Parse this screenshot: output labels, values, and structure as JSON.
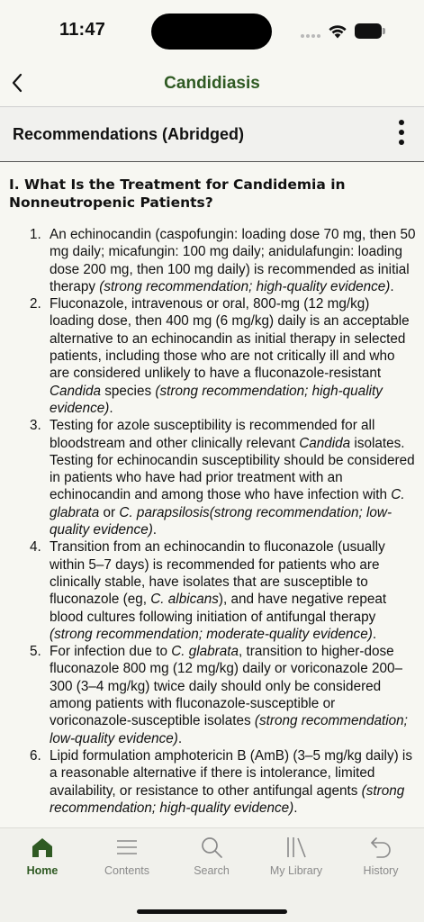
{
  "status": {
    "time": "11:47"
  },
  "nav": {
    "title": "Candidiasis"
  },
  "section": {
    "title": "Recommendations (Abridged)"
  },
  "question": {
    "heading": "I. What Is the Treatment for Candidemia in Nonneutropenic Patients?"
  },
  "recommendations": [
    {
      "number": "1.",
      "parts": [
        {
          "t": "An echinocandin (caspofungin: loading dose 70 mg, then 50 mg daily; micafungin: 100 mg daily; anidulafungin: loading dose 200 mg, then 100 mg daily) is recommended as initial therapy "
        },
        {
          "t": "(strong recommendation; high-quality evidence)",
          "i": true
        },
        {
          "t": "."
        }
      ]
    },
    {
      "number": "2.",
      "parts": [
        {
          "t": "Fluconazole, intravenous or oral, 800-mg (12 mg/kg) loading dose, then 400 mg (6 mg/kg) daily is an acceptable alternative to an echinocandin as initial therapy in selected patients, including those who are not critically ill and who are considered unlikely to have a fluconazole-resistant "
        },
        {
          "t": "Candida",
          "i": true
        },
        {
          "t": " species "
        },
        {
          "t": "(strong recommendation; high-quality evidence)",
          "i": true
        },
        {
          "t": "."
        }
      ]
    },
    {
      "number": "3.",
      "parts": [
        {
          "t": "Testing for azole susceptibility is recommended for all bloodstream and other clinically relevant "
        },
        {
          "t": "Candida",
          "i": true
        },
        {
          "t": " isolates. Testing for echinocandin susceptibility should be considered in patients who have had prior treatment with an echinocandin and among those who have infection with "
        },
        {
          "t": "C. glabrata",
          "i": true
        },
        {
          "t": " or "
        },
        {
          "t": "C. parapsilosis(strong recommendation; low-quality evidence)",
          "i": true
        },
        {
          "t": "."
        }
      ]
    },
    {
      "number": "4.",
      "parts": [
        {
          "t": "Transition from an echinocandin to fluconazole (usually within 5–7 days) is recommended for patients who are clinically stable, have isolates that are susceptible to fluconazole (eg, "
        },
        {
          "t": "C. albicans",
          "i": true
        },
        {
          "t": "), and have negative repeat blood cultures following initiation of antifungal therapy "
        },
        {
          "t": "(strong recommendation; moderate-quality evidence)",
          "i": true
        },
        {
          "t": "."
        }
      ]
    },
    {
      "number": "5.",
      "parts": [
        {
          "t": "For infection due to "
        },
        {
          "t": "C. glabrata",
          "i": true
        },
        {
          "t": ", transition to higher-dose fluconazole 800 mg (12 mg/kg) daily or voriconazole 200–300 (3–4 mg/kg) twice daily should only be considered among patients with fluconazole-susceptible or voriconazole-susceptible isolates "
        },
        {
          "t": "(strong recommendation; low-quality evidence)",
          "i": true
        },
        {
          "t": "."
        }
      ]
    },
    {
      "number": "6.",
      "parts": [
        {
          "t": "Lipid formulation amphotericin B (AmB) (3–5 mg/kg daily) is a reasonable alternative if there is intolerance, limited availability, or resistance to other antifungal agents "
        },
        {
          "t": "(strong recommendation; high-quality evidence)",
          "i": true
        },
        {
          "t": "."
        }
      ]
    }
  ],
  "tabs": [
    {
      "label": "Home",
      "icon": "home-icon",
      "active": true
    },
    {
      "label": "Contents",
      "icon": "contents-icon",
      "active": false
    },
    {
      "label": "Search",
      "icon": "search-icon",
      "active": false
    },
    {
      "label": "My Library",
      "icon": "library-icon",
      "active": false
    },
    {
      "label": "History",
      "icon": "history-icon",
      "active": false
    }
  ],
  "colors": {
    "accent": "#2f5a23",
    "inactive": "#8a8a8a",
    "background": "#f7f7f2"
  }
}
